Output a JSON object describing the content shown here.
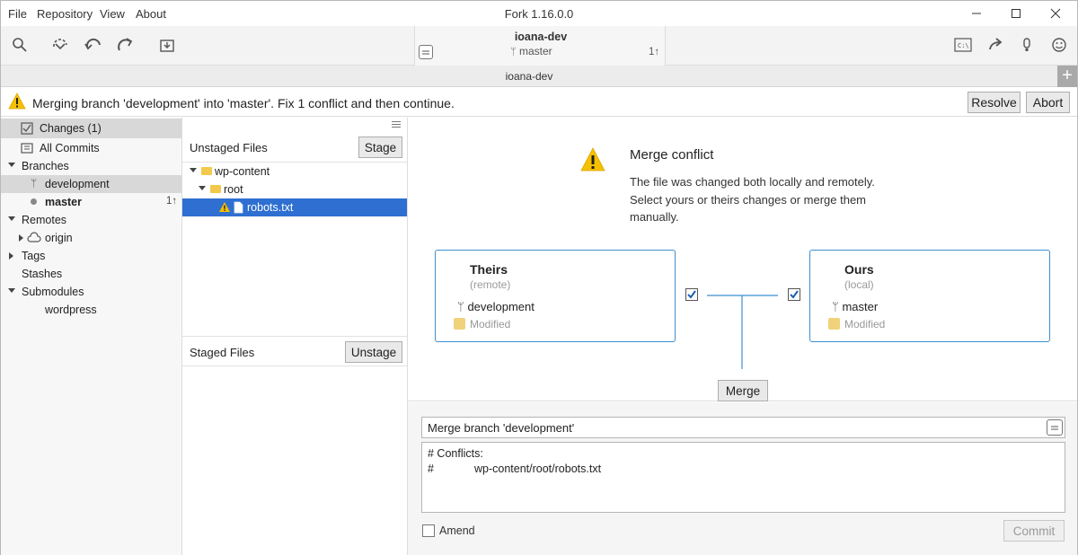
{
  "window": {
    "title": "Fork 1.16.0.0",
    "menu": [
      "File",
      "Repository",
      "View",
      "About"
    ]
  },
  "toolbar": {
    "icons": [
      "search-icon",
      "fetch-icon",
      "pull-icon",
      "push-icon",
      "stash-icon",
      "terminal-icon",
      "share-icon",
      "lfs-icon",
      "smiley-icon"
    ],
    "repo_name": "ioana-dev",
    "branch": "master",
    "ahead": "1↑"
  },
  "tab": {
    "label": "ioana-dev",
    "add": "+"
  },
  "banner": {
    "message": "Merging branch 'development' into 'master'. Fix 1 conflict and then continue.",
    "resolve_label": "Resolve",
    "abort_label": "Abort"
  },
  "sidebar": {
    "changes": "Changes (1)",
    "all_commits": "All Commits",
    "branches": "Branches",
    "branch_items": [
      {
        "label": "development",
        "selected": true
      },
      {
        "label": "master",
        "current": true,
        "badge": "1↑"
      }
    ],
    "remotes": "Remotes",
    "remote_items": [
      "origin"
    ],
    "tags": "Tags",
    "stashes": "Stashes",
    "submodules": "Submodules",
    "submodule_items": [
      "wordpress"
    ]
  },
  "files": {
    "unstaged_title": "Unstaged Files",
    "stage_label": "Stage",
    "tree": [
      {
        "label": "wp-content",
        "type": "folder"
      },
      {
        "label": "root",
        "type": "folder"
      },
      {
        "label": "robots.txt",
        "type": "file",
        "conflict": true
      }
    ],
    "staged_title": "Staged Files",
    "unstage_label": "Unstage"
  },
  "conflict": {
    "title": "Merge conflict",
    "description": "The file was changed both locally and remotely. Select yours or theirs changes or merge them manually.",
    "theirs": {
      "title": "Theirs",
      "sub": "(remote)",
      "branch": "development",
      "status": "Modified",
      "checked": true
    },
    "ours": {
      "title": "Ours",
      "sub": "(local)",
      "branch": "master",
      "status": "Modified",
      "checked": true
    },
    "merge_label": "Merge"
  },
  "commit": {
    "subject": "Merge branch 'development'",
    "body_line1": "# Conflicts:",
    "body_line2_prefix": "#",
    "body_line2_path": "wp-content/root/robots.txt",
    "amend_label": "Amend",
    "commit_label": "Commit"
  },
  "colors": {
    "accent": "#2e6fd1",
    "card_border": "#3b8fd0",
    "warning": "#f6c000"
  }
}
